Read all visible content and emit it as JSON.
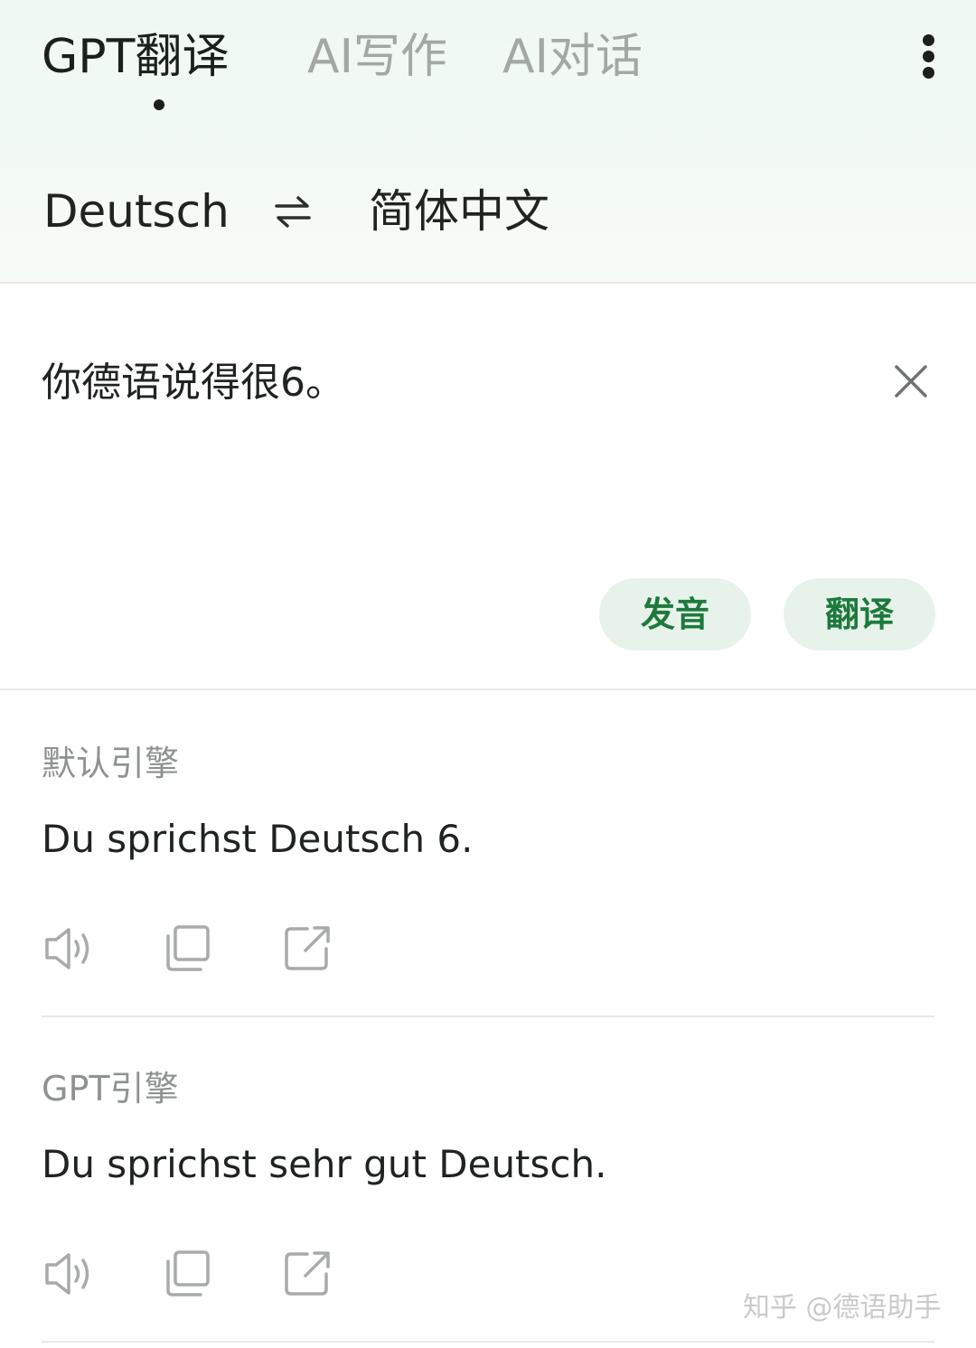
{
  "header": {
    "tabs": [
      {
        "label": "GPT翻译",
        "active": true
      },
      {
        "label": "AI写作",
        "active": false
      },
      {
        "label": "AI对话",
        "active": false
      }
    ],
    "more_icon": "more-vertical-icon"
  },
  "languages": {
    "source": "Deutsch",
    "target": "简体中文",
    "swap_icon": "swap-arrows-icon"
  },
  "input": {
    "text": "你德语说得很6。",
    "clear_icon": "close-icon"
  },
  "buttons": {
    "speak": "发音",
    "translate": "翻译"
  },
  "results": [
    {
      "engine": "默认引擎",
      "text": "Du sprichst Deutsch 6."
    },
    {
      "engine": "GPT引擎",
      "text": "Du sprichst sehr gut Deutsch."
    }
  ],
  "result_actions": [
    "speaker-icon",
    "copy-icon",
    "share-icon"
  ],
  "watermark": "知乎 @德语助手",
  "colors": {
    "accent": "#1d7a3c",
    "pill_bg": "#e7f3ea",
    "muted": "#a3a8a4",
    "header_bg": "#eef9f1"
  }
}
